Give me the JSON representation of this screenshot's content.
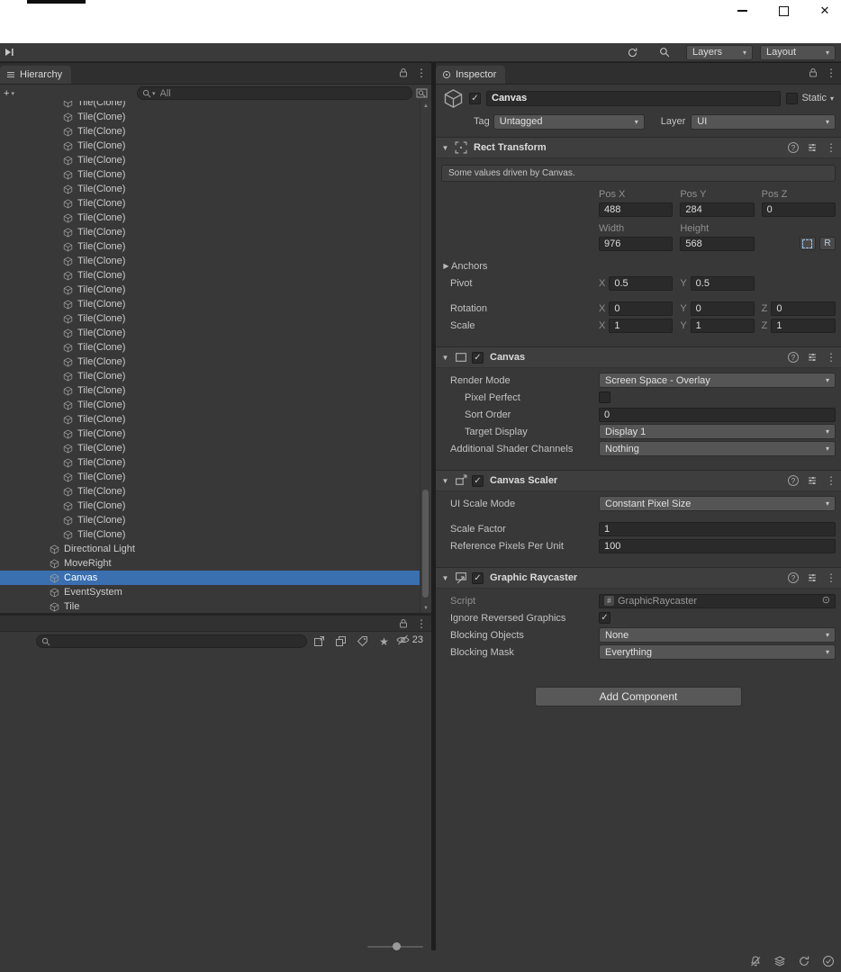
{
  "icons": {
    "caret": "▾",
    "fold_open": "▼",
    "fold_closed": "▶",
    "kebab": "⋮",
    "check": "✓",
    "plus": "+",
    "help": "?",
    "star": "★",
    "picker": "⊙",
    "script_badge": "#",
    "close": "✕",
    "up": "▲",
    "down": "▼"
  },
  "toolbar": {
    "layers": "Layers",
    "layout": "Layout"
  },
  "left": {
    "hierarchy_tab": "Hierarchy",
    "search_placeholder": "All",
    "tree": {
      "items": [
        {
          "label": "Tile(Clone)",
          "indent": 2,
          "repeat": 31
        },
        {
          "label": "Directional Light",
          "indent": 1
        },
        {
          "label": "MoveRight",
          "indent": 1
        },
        {
          "label": "Canvas",
          "indent": 1,
          "selected": true
        },
        {
          "label": "EventSystem",
          "indent": 1
        },
        {
          "label": "Tile",
          "indent": 1
        }
      ]
    },
    "bottom_panel": {
      "hidden_count": "23"
    }
  },
  "inspector": {
    "tab": "Inspector",
    "header": {
      "name": "Canvas",
      "static_label": "Static"
    },
    "tags": {
      "tag_label": "Tag",
      "tag_value": "Untagged",
      "layer_label": "Layer",
      "layer_value": "UI"
    },
    "axis": {
      "x": "X",
      "y": "Y",
      "z": "Z"
    },
    "rect_transform": {
      "title": "Rect Transform",
      "info": "Some values driven by Canvas.",
      "pos_x_label": "Pos X",
      "pos_y_label": "Pos Y",
      "pos_z_label": "Pos Z",
      "pos_x": "488",
      "pos_y": "284",
      "pos_z": "0",
      "width_label": "Width",
      "height_label": "Height",
      "width": "976",
      "height": "568",
      "r_label": "R",
      "anchors_label": "Anchors",
      "pivot_label": "Pivot",
      "pivot_x": "0.5",
      "pivot_y": "0.5",
      "rotation_label": "Rotation",
      "rotation_x": "0",
      "rotation_y": "0",
      "rotation_z": "0",
      "scale_label": "Scale",
      "scale_x": "1",
      "scale_y": "1",
      "scale_z": "1"
    },
    "canvas": {
      "title": "Canvas",
      "render_mode_label": "Render Mode",
      "render_mode": "Screen Space - Overlay",
      "pixel_perfect_label": "Pixel Perfect",
      "sort_order_label": "Sort Order",
      "sort_order": "0",
      "target_display_label": "Target Display",
      "target_display": "Display 1",
      "shader_channels_label": "Additional Shader Channels",
      "shader_channels": "Nothing"
    },
    "canvas_scaler": {
      "title": "Canvas Scaler",
      "ui_scale_mode_label": "UI Scale Mode",
      "ui_scale_mode": "Constant Pixel Size",
      "scale_factor_label": "Scale Factor",
      "scale_factor": "1",
      "ref_ppu_label": "Reference Pixels Per Unit",
      "ref_ppu": "100"
    },
    "graphic_raycaster": {
      "title": "Graphic Raycaster",
      "script_label": "Script",
      "script_value": "GraphicRaycaster",
      "ignore_reversed_label": "Ignore Reversed Graphics",
      "blocking_objects_label": "Blocking Objects",
      "blocking_objects": "None",
      "blocking_mask_label": "Blocking Mask",
      "blocking_mask": "Everything"
    },
    "add_component_label": "Add Component"
  }
}
